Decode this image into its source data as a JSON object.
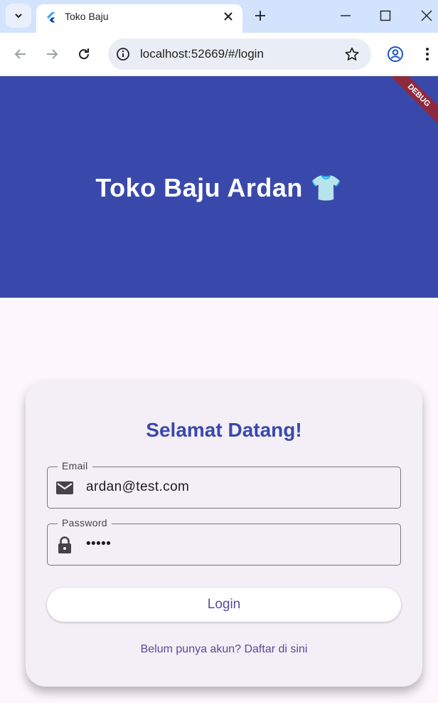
{
  "browser": {
    "tab_title": "Toko Baju",
    "url": "localhost:52669/#/login",
    "icons": [
      "tab-search-icon",
      "flutter-icon",
      "close-icon",
      "plus-icon",
      "minimize-icon",
      "maximize-icon",
      "window-close-icon",
      "back-arrow-icon",
      "forward-arrow-icon",
      "reload-icon",
      "info-icon",
      "star-icon",
      "profile-icon",
      "kebab-menu-icon"
    ]
  },
  "app": {
    "title": "Toko Baju Ardan 👕",
    "debug_banner": "DEBUG",
    "card": {
      "heading": "Selamat Datang!",
      "email": {
        "label": "Email",
        "value": "ardan@test.com"
      },
      "password": {
        "label": "Password",
        "value": "•••••"
      },
      "login_label": "Login",
      "register_text": "Belum punya akun? Daftar di sini"
    },
    "colors": {
      "header": "#3949ab",
      "background": "#fdf7fd",
      "card": "#f4eef6",
      "accent": "#5b4a9e",
      "debug": "#8e2a3e"
    }
  }
}
